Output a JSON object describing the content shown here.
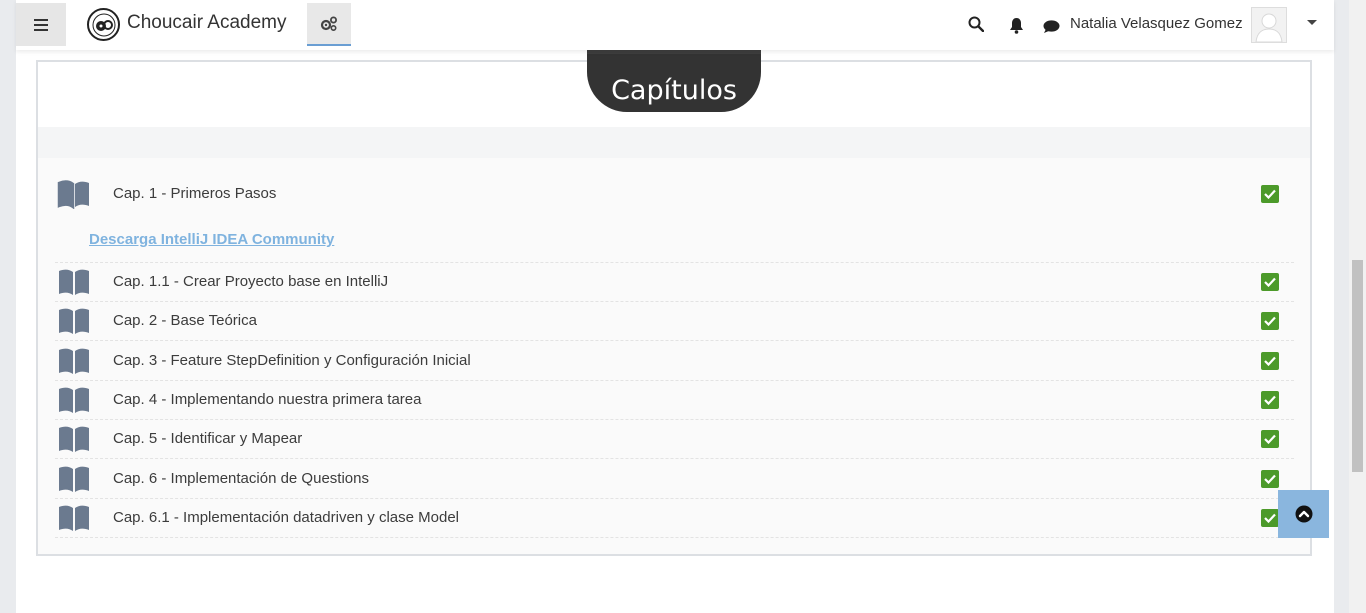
{
  "navbar": {
    "brand": "Choucair Academy",
    "user_name": "Natalia Velasquez Gomez",
    "icons": {
      "menu": "hamburger-icon",
      "settings": "gears-icon",
      "search": "search-icon",
      "notifications": "bell-icon",
      "messages": "chat-bubble-icon",
      "user_menu": "caret-down-icon"
    }
  },
  "section": {
    "title": "Capítulos"
  },
  "chapters": [
    {
      "label": "Cap. 1 - Primeros Pasos",
      "completed": true
    },
    {
      "label": "Cap. 1.1 - Crear Proyecto base en IntelliJ",
      "completed": true
    },
    {
      "label": "Cap. 2 - Base Teórica",
      "completed": true
    },
    {
      "label": "Cap. 3 - Feature StepDefinition y Configuración Inicial",
      "completed": true
    },
    {
      "label": "Cap. 4 - Implementando nuestra primera tarea",
      "completed": true
    },
    {
      "label": "Cap. 5 - Identificar y Mapear",
      "completed": true
    },
    {
      "label": "Cap. 6 - Implementación de Questions",
      "completed": true
    },
    {
      "label": "Cap. 6.1 - Implementación datadriven y clase Model",
      "completed": true
    }
  ],
  "download_link": "Descarga IntelliJ IDEA Community",
  "colors": {
    "check": "#4c9a2a",
    "link": "#7fb3df",
    "book": "#6b7a8f",
    "pill": "#333333",
    "back_to_top": "#8ab6de"
  }
}
